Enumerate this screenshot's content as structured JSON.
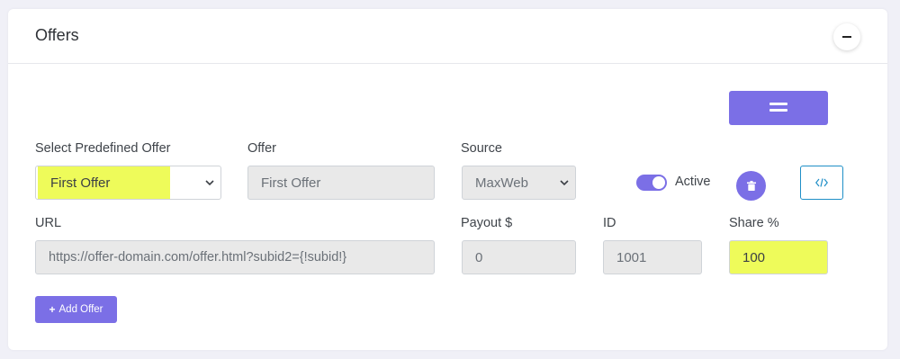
{
  "card": {
    "title": "Offers"
  },
  "labels": {
    "predefined": "Select Predefined Offer",
    "offer": "Offer",
    "source": "Source",
    "url": "URL",
    "payout": "Payout $",
    "id": "ID",
    "share": "Share %"
  },
  "fields": {
    "predefined_value": "First Offer",
    "offer_value": "First Offer",
    "source_value": "MaxWeb",
    "url_value": "https://offer-domain.com/offer.html?subid2={!subid!}",
    "payout_value": "0",
    "id_value": "1001",
    "share_value": "100"
  },
  "toggle": {
    "label": "Active",
    "on": true
  },
  "buttons": {
    "add_offer": "Add Offer"
  },
  "colors": {
    "accent": "#7b6fe6",
    "highlight": "#eefb5a",
    "code_button_border": "#1f8fc7"
  },
  "icons": {
    "collapse": "minus-icon",
    "reorder": "equals-icon",
    "delete": "trash-icon",
    "code": "code-icon",
    "add": "plus-icon"
  }
}
